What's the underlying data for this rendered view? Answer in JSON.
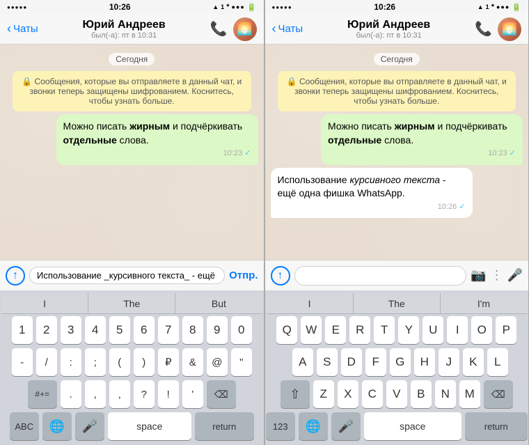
{
  "left_panel": {
    "status": {
      "dots": "●●●●●",
      "time": "10:26",
      "signal": "●●●●●",
      "icons": "▲ 1 ⚡ 🔋"
    },
    "nav": {
      "back_label": "Чаты",
      "name": "Юрий Андреев",
      "subtitle": "был(-а): пт в 10:31"
    },
    "date_badge": "Сегодня",
    "system_message": "🔒 Сообщения, которые вы отправляете в данный чат, и звонки теперь защищены шифрованием. Коснитесь, чтобы узнать больше.",
    "bubble_sent": {
      "text_html": "Можно писать <b>жирным</b> и подчёркивать <b>отдельные</b> слова.",
      "time": "10:23",
      "check": "✓"
    },
    "input_value": "Использование _курсивного текста_ - ещё одна фишка WhatsApp.",
    "send_label": "Отпр.",
    "keyboard": {
      "suggestions": [
        "I",
        "The",
        "But"
      ],
      "row1": [
        "1",
        "2",
        "3",
        "4",
        "5",
        "6",
        "7",
        "8",
        "9",
        "0"
      ],
      "row2": [
        "-",
        "/",
        ":",
        ";",
        "(",
        ")",
        "₽",
        "&",
        "@",
        "\""
      ],
      "row3_left": "#+=",
      "row3_mid": [
        ".",
        "‚",
        ",",
        "?",
        "!",
        "'"
      ],
      "row3_right": "⌫",
      "row4": [
        "ABC",
        "🌐",
        "🎤",
        "space",
        "return"
      ]
    }
  },
  "right_panel": {
    "status": {
      "dots": "●●●●●",
      "time": "10:26",
      "signal": "●●●●●",
      "icons": "▲ 1 ⚡ 🔋"
    },
    "nav": {
      "back_label": "Чаты",
      "name": "Юрий Андреев",
      "subtitle": "был(-а): пт в 10:31"
    },
    "date_badge": "Сегодня",
    "system_message": "🔒 Сообщения, которые вы отправляете в данный чат, и звонки теперь защищены шифрованием. Коснитесь, чтобы узнать больше.",
    "bubble_sent": {
      "text_html": "Можно писать <b>жирным</b> и подчёркивать <b>отдельные</b> слова.",
      "time": "10:23",
      "check": "✓"
    },
    "bubble_received": {
      "text_html": "Использование <i>курсивного текста</i> - ещё одна фишка WhatsApp.",
      "time": "10:26",
      "check": "✓"
    },
    "input_placeholder": "",
    "keyboard": {
      "suggestions": [
        "I",
        "The",
        "I'm"
      ],
      "row1": [
        "Q",
        "W",
        "E",
        "R",
        "T",
        "Y",
        "U",
        "I",
        "O",
        "P"
      ],
      "row2": [
        "A",
        "S",
        "D",
        "F",
        "G",
        "H",
        "J",
        "K",
        "L"
      ],
      "row3_left": "⇧",
      "row3_mid": [
        "Z",
        "X",
        "C",
        "V",
        "B",
        "N",
        "M"
      ],
      "row3_right": "⌫",
      "row4_left": "123",
      "row4_globe": "🌐",
      "row4_mic": "🎤",
      "row4_space": "space",
      "row4_return": "return"
    }
  }
}
